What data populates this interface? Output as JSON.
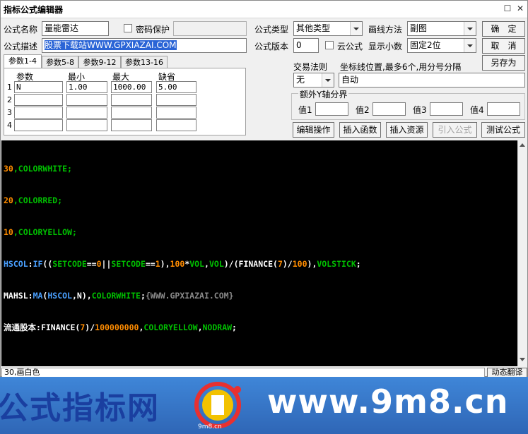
{
  "window": {
    "title": "指标公式编辑器"
  },
  "form": {
    "name_label": "公式名称",
    "name_value": "量能雷达",
    "password_label": "密码保护",
    "desc_label": "公式描述",
    "desc_value": "股票下载站WWW.GPXIAZAI.COM",
    "type_label": "公式类型",
    "type_value": "其他类型",
    "draw_label": "画线方法",
    "draw_value": "副图",
    "version_label": "公式版本",
    "version_value": "0",
    "cloud_label": "云公式",
    "decimal_label": "显示小数",
    "decimal_value": "固定2位",
    "trade_label": "交易法则",
    "trade_value": "无",
    "coord_label": "坐标线位置,最多6个,用分号分隔",
    "coord_value": "自动",
    "yaxis_label": "额外Y轴分界",
    "val_labels": [
      "值1",
      "值2",
      "值3",
      "值4"
    ]
  },
  "buttons": {
    "ok": "确　定",
    "cancel": "取　消",
    "save_as": "另存为",
    "edit_op": "编辑操作",
    "insert_func": "插入函数",
    "insert_res": "插入资源",
    "import": "引入公式",
    "test": "测试公式",
    "dynamic_translate": "动态翻译"
  },
  "tabs": [
    "参数1-4",
    "参数5-8",
    "参数9-12",
    "参数13-16"
  ],
  "params": {
    "headers": [
      "参数",
      "最小",
      "最大",
      "缺省"
    ],
    "rows": [
      {
        "idx": "1",
        "name": "N",
        "min": "1.00",
        "max": "1000.00",
        "def": "5.00"
      },
      {
        "idx": "2",
        "name": "",
        "min": "",
        "max": "",
        "def": ""
      },
      {
        "idx": "3",
        "name": "",
        "min": "",
        "max": "",
        "def": ""
      },
      {
        "idx": "4",
        "name": "",
        "min": "",
        "max": "",
        "def": ""
      }
    ]
  },
  "code": {
    "line1": [
      {
        "t": "30",
        "c": "#ff8c00"
      },
      {
        "t": ",COLORWHITE;",
        "c": "#00c000"
      }
    ],
    "line2": [
      {
        "t": "20",
        "c": "#ff8c00"
      },
      {
        "t": ",COLORRED;",
        "c": "#00c000"
      }
    ],
    "line3": [
      {
        "t": "10",
        "c": "#ff8c00"
      },
      {
        "t": ",COLORYELLOW;",
        "c": "#00c000"
      }
    ],
    "line4": [
      {
        "t": "HSCOL",
        "c": "#4aa0ff"
      },
      {
        "t": ":",
        "c": "#ffffff"
      },
      {
        "t": "IF",
        "c": "#4aa0ff"
      },
      {
        "t": "((",
        "c": "#ffffff"
      },
      {
        "t": "SETCODE",
        "c": "#00c000"
      },
      {
        "t": "==",
        "c": "#ffffff"
      },
      {
        "t": "0",
        "c": "#ff8c00"
      },
      {
        "t": "||",
        "c": "#ffffff"
      },
      {
        "t": "SETCODE",
        "c": "#00c000"
      },
      {
        "t": "==",
        "c": "#ffffff"
      },
      {
        "t": "1",
        "c": "#ff8c00"
      },
      {
        "t": "),",
        "c": "#ffffff"
      },
      {
        "t": "100",
        "c": "#ff8c00"
      },
      {
        "t": "*",
        "c": "#ffffff"
      },
      {
        "t": "VOL",
        "c": "#00c000"
      },
      {
        "t": ",",
        "c": "#ffffff"
      },
      {
        "t": "VOL",
        "c": "#00c000"
      },
      {
        "t": ")/(",
        "c": "#ffffff"
      },
      {
        "t": "FINANCE",
        "c": "#ffffff"
      },
      {
        "t": "(",
        "c": "#ffffff"
      },
      {
        "t": "7",
        "c": "#ff8c00"
      },
      {
        "t": ")/",
        "c": "#ffffff"
      },
      {
        "t": "100",
        "c": "#ff8c00"
      },
      {
        "t": "),",
        "c": "#ffffff"
      },
      {
        "t": "VOLSTICK",
        "c": "#00c000"
      },
      {
        "t": ";",
        "c": "#ffffff"
      }
    ],
    "line5": [
      {
        "t": "MAHSL",
        "c": "#ffffff"
      },
      {
        "t": ":",
        "c": "#ffffff"
      },
      {
        "t": "MA",
        "c": "#4aa0ff"
      },
      {
        "t": "(",
        "c": "#ffffff"
      },
      {
        "t": "HSCOL",
        "c": "#4aa0ff"
      },
      {
        "t": ",N),",
        "c": "#ffffff"
      },
      {
        "t": "COLORWHITE",
        "c": "#00c000"
      },
      {
        "t": ";",
        "c": "#ffffff"
      },
      {
        "t": "{WWW.GPXIAZAI.COM}",
        "c": "#8a8a8a"
      }
    ],
    "line6": [
      {
        "t": "流通股本",
        "c": "#ffffff"
      },
      {
        "t": ":",
        "c": "#ffffff"
      },
      {
        "t": "FINANCE",
        "c": "#ffffff"
      },
      {
        "t": "(",
        "c": "#ffffff"
      },
      {
        "t": "7",
        "c": "#ff8c00"
      },
      {
        "t": ")/",
        "c": "#ffffff"
      },
      {
        "t": "100000000",
        "c": "#ff8c00"
      },
      {
        "t": ",",
        "c": "#ffffff"
      },
      {
        "t": "COLORYELLOW",
        "c": "#00c000"
      },
      {
        "t": ",",
        "c": "#ffffff"
      },
      {
        "t": "NODRAW",
        "c": "#00c000"
      },
      {
        "t": ";",
        "c": "#ffffff"
      }
    ]
  },
  "status": {
    "text": "30,画白色"
  },
  "banner": {
    "left_text": "公式指标网",
    "logo_text": "9m8.cn",
    "right_text": "www.9m8.cn",
    "colors": {
      "left": "#1a3fa0",
      "right": "#ffffff"
    }
  }
}
